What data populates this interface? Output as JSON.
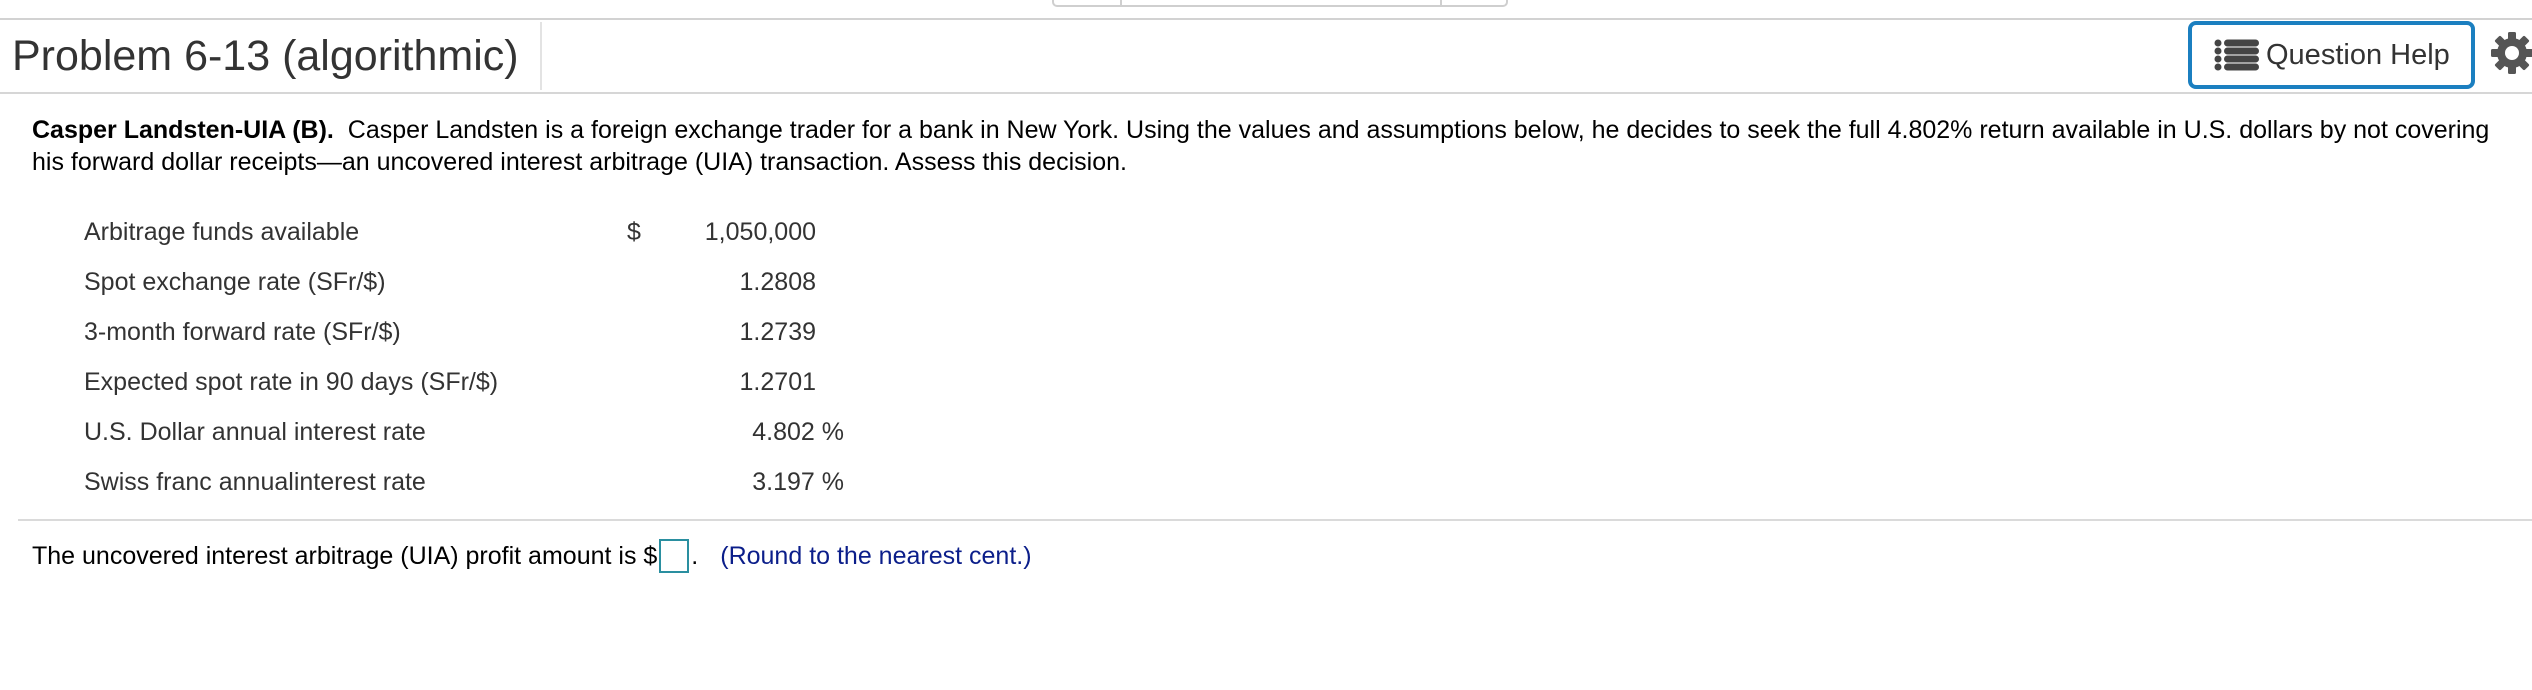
{
  "header": {
    "title": "Problem 6-13 (algorithmic)",
    "help_button_label": "Question Help"
  },
  "problem": {
    "bold_lead": "Casper Landsten-UIA (B).",
    "text": "Casper Landsten is a foreign exchange trader for a bank in New York. Using the values and assumptions below, he decides to seek the full 4.802% return available in U.S. dollars by not covering his forward dollar receipts—an uncovered interest arbitrage (UIA) transaction. Assess this decision."
  },
  "inputs": [
    {
      "label": "Arbitrage funds available",
      "currency": "$",
      "value": "1,050,000",
      "unit": ""
    },
    {
      "label": "Spot exchange rate (SFr/$)",
      "currency": "",
      "value": "1.2808",
      "unit": ""
    },
    {
      "label": "3-month forward rate (SFr/$)",
      "currency": "",
      "value": "1.2739",
      "unit": ""
    },
    {
      "label": "Expected spot rate in 90 days (SFr/$)",
      "currency": "",
      "value": "1.2701",
      "unit": ""
    },
    {
      "label": "U.S. Dollar annual interest rate",
      "currency": "",
      "value": "4.802",
      "unit": "%"
    },
    {
      "label": "Swiss franc annualinterest rate",
      "currency": "",
      "value": "3.197",
      "unit": "%"
    }
  ],
  "answer": {
    "prefix": "The uncovered interest arbitrage (UIA) profit amount is $",
    "input_value": "",
    "suffix": ".",
    "hint": "(Round to the nearest cent.)"
  },
  "colors": {
    "accent": "#1b7fc0",
    "hint": "#0b1e8a",
    "input_border": "#2a8fa0"
  }
}
